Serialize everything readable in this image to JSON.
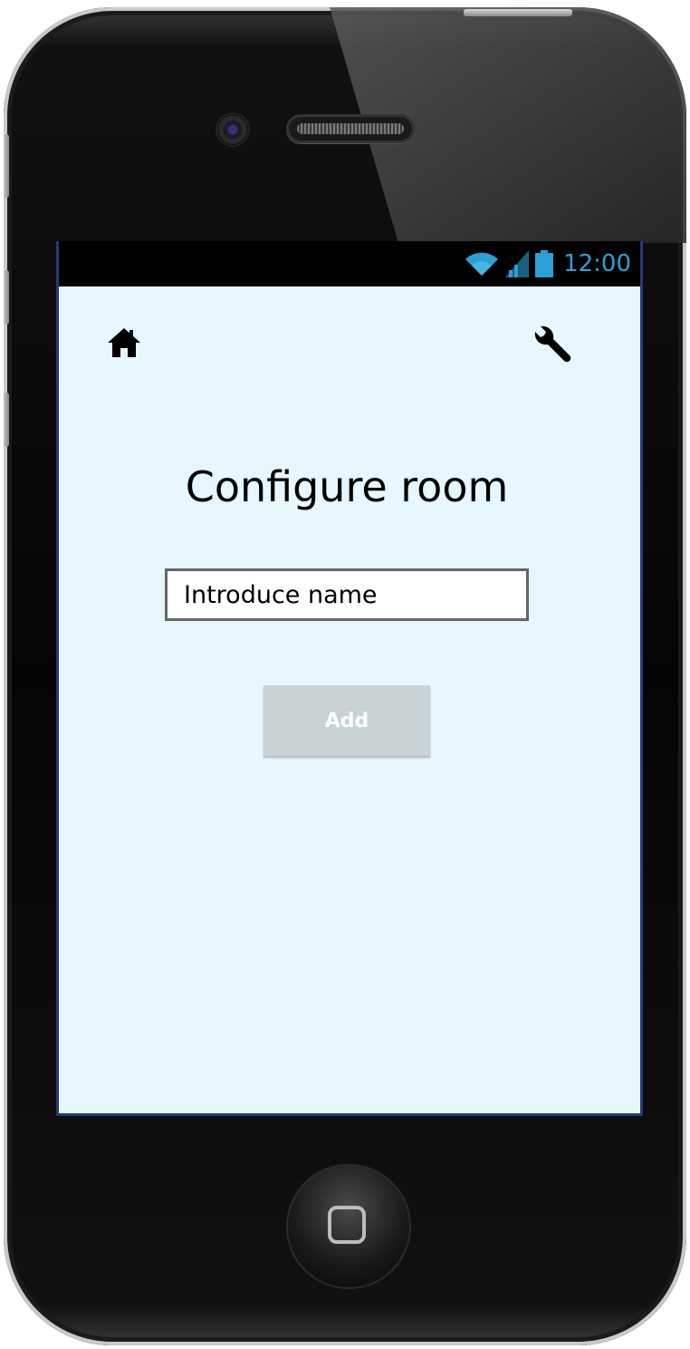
{
  "status_bar": {
    "time": "12:00",
    "icons": [
      "wifi-icon",
      "signal-icon",
      "battery-icon"
    ],
    "accent_color": "#2aa0d6"
  },
  "header": {
    "left_icon": "home-icon",
    "right_icon": "wrench-icon"
  },
  "main": {
    "title": "Configure room",
    "name_input": {
      "value": "",
      "placeholder": "Introduce name"
    },
    "add_button_label": "Add"
  },
  "colors": {
    "screen_background": "#e6f7fd",
    "button_background": "#c9d2d5",
    "screen_border": "#243a7e"
  }
}
